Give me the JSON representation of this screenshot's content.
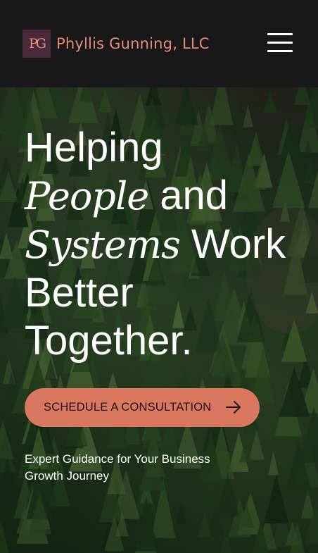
{
  "header": {
    "logo_monogram": "PG",
    "brand_name": "Phyllis Gunning, LLC",
    "menu_icon": "hamburger-menu-icon"
  },
  "hero": {
    "headline": {
      "line1": "Helping",
      "line2_em": "People",
      "line2_rest": " and",
      "line3_em": "Systems",
      "line3_rest": " Work",
      "line4": "Better",
      "line5": "Together."
    },
    "cta_label": "SCHEDULE A CONSULTATION",
    "cta_icon": "arrow-right-icon",
    "subtext": "Expert Guidance for Your Business Growth Journey",
    "background_image": "aerial forest treetops"
  },
  "colors": {
    "header_bg": "#181818",
    "brand": "#e58d74",
    "logo_bg": "#4a2a3a",
    "cta_bg": "#d9775f",
    "text": "#ffffff"
  }
}
